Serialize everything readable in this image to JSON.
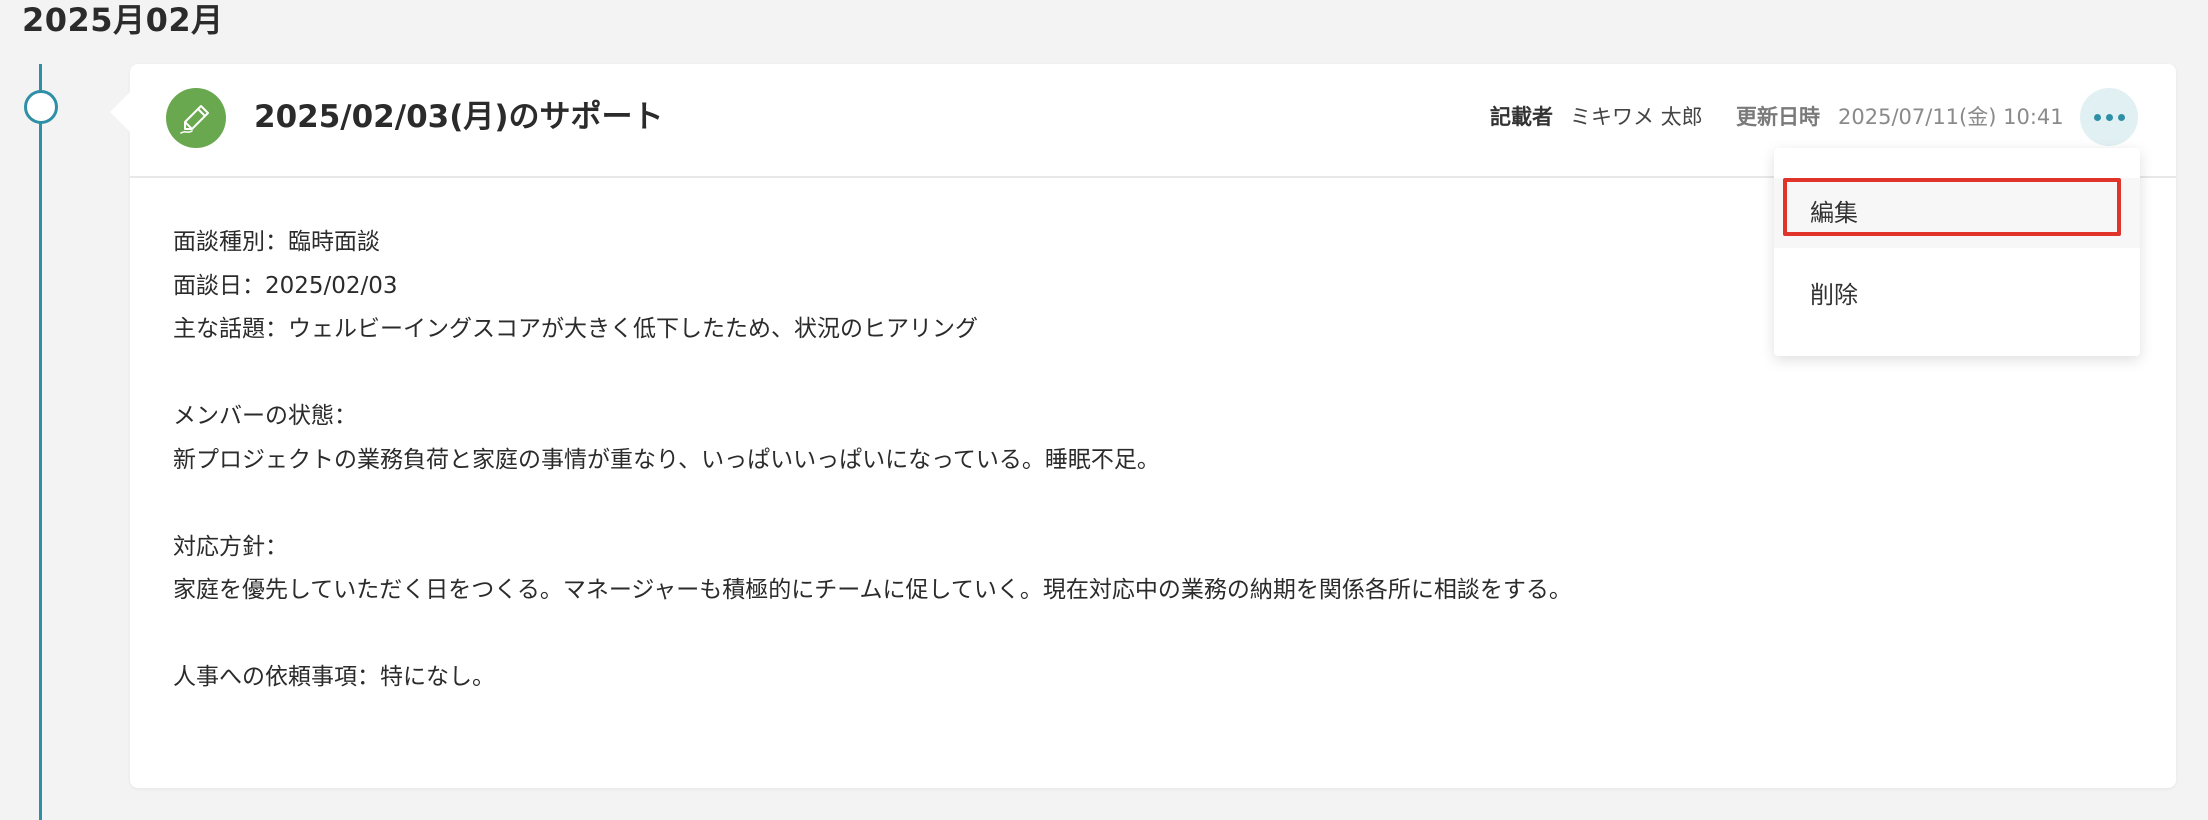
{
  "timeline": {
    "month_heading": "2025月02月"
  },
  "record": {
    "title": "2025/02/03(月)のサポート",
    "author_label": "記載者",
    "author_value": "ミキワメ 太郎",
    "updated_label": "更新日時",
    "updated_value": "2025/07/11(金) 10:41",
    "icon": "pencil-icon",
    "icon_color": "#6aa84f",
    "body_lines": [
      "面談種別：臨時面談",
      "面談日：2025/02/03",
      "主な話題：ウェルビーイングスコアが大きく低下したため、状況のヒアリング",
      "",
      "メンバーの状態：",
      "新プロジェクトの業務負荷と家庭の事情が重なり、いっぱいいっぱいになっている。睡眠不足。",
      "",
      "対応方針：",
      "家庭を優先していただく日をつくる。マネージャーも積極的にチームに促していく。現在対応中の業務の納期を関係各所に相談をする。",
      "",
      "人事への依頼事項：特になし。"
    ]
  },
  "menu": {
    "more_icon": "more-horizontal-icon",
    "items": [
      {
        "label": "編集"
      },
      {
        "label": "削除"
      }
    ],
    "highlight_color": "#e0342a"
  },
  "colors": {
    "accent": "#2f8fa6",
    "background": "#f3f3f3"
  }
}
